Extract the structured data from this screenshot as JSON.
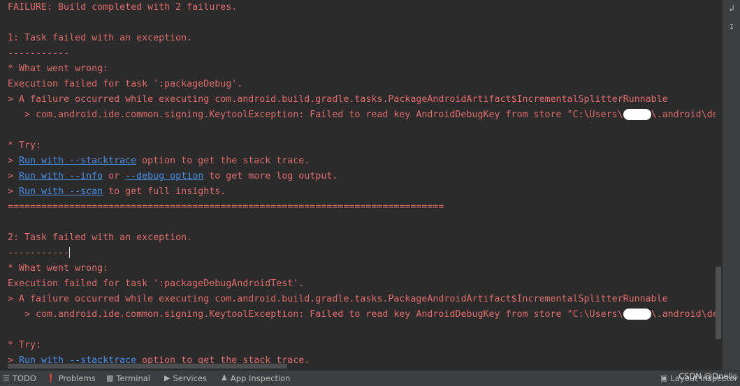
{
  "console": {
    "lines": [
      [
        {
          "t": "FAILURE: Build completed with 2 failures."
        }
      ],
      [],
      [
        {
          "t": "1: Task failed with an exception."
        }
      ],
      [
        {
          "t": "-----------"
        }
      ],
      [
        {
          "t": "* What went wrong:"
        }
      ],
      [
        {
          "t": "Execution failed for task ':packageDebug'."
        }
      ],
      [
        {
          "t": "> A failure occurred while executing com.android.build.gradle.tasks.PackageAndroidArtifact$IncrementalSplitterRunnable"
        }
      ],
      [
        {
          "t": "   > com.android.ide.common.signing.KeytoolException: Failed to read key AndroidDebugKey from store \"C:\\Users\\"
        },
        {
          "redact": true
        },
        {
          "t": "\\.android\\deb"
        }
      ],
      [],
      [
        {
          "t": "* Try:"
        }
      ],
      [
        {
          "t": "> "
        },
        {
          "t": "Run with --stacktrace",
          "link": true
        },
        {
          "t": " option to get the stack trace."
        }
      ],
      [
        {
          "t": "> "
        },
        {
          "t": "Run with --info",
          "link": true
        },
        {
          "t": " or "
        },
        {
          "t": "--debug option",
          "link": true
        },
        {
          "t": " to get more log output."
        }
      ],
      [
        {
          "t": "> "
        },
        {
          "t": "Run with --scan",
          "link": true
        },
        {
          "t": " to get full insights."
        }
      ],
      [
        {
          "t": "=============================================================================="
        }
      ],
      [],
      [
        {
          "t": "2: Task failed with an exception."
        }
      ],
      [
        {
          "t": "-----------"
        },
        {
          "cursor": true
        }
      ],
      [
        {
          "t": "* What went wrong:"
        }
      ],
      [
        {
          "t": "Execution failed for task ':packageDebugAndroidTest'."
        }
      ],
      [
        {
          "t": "> A failure occurred while executing com.android.build.gradle.tasks.PackageAndroidArtifact$IncrementalSplitterRunnable"
        }
      ],
      [
        {
          "t": "   > com.android.ide.common.signing.KeytoolException: Failed to read key AndroidDebugKey from store \"C:\\Users\\"
        },
        {
          "redact": true
        },
        {
          "t": "\\.android\\deb"
        }
      ],
      [],
      [
        {
          "t": "* Try:"
        }
      ],
      [
        {
          "t": "> "
        },
        {
          "t": "Run with --stacktrace",
          "link": true
        },
        {
          "t": " option to get the stack trace."
        }
      ]
    ]
  },
  "gutter": {
    "icons": [
      "soft-wrap-icon",
      "scroll-to-end-icon"
    ]
  },
  "toolbar": {
    "items": [
      {
        "label": "TODO",
        "icon": "list-icon"
      },
      {
        "label": "Problems",
        "icon": "warning-icon"
      },
      {
        "label": "Terminal",
        "icon": "terminal-icon"
      },
      {
        "label": "Services",
        "icon": "services-icon"
      },
      {
        "label": "App Inspection",
        "icon": "app-inspection-icon"
      }
    ],
    "right_label": "Layout Inspector",
    "watermark": "CSDN @Dnelic"
  },
  "colors": {
    "background": "#2b2b2b",
    "error_text": "#e06c6c",
    "link": "#4a8fe7"
  }
}
